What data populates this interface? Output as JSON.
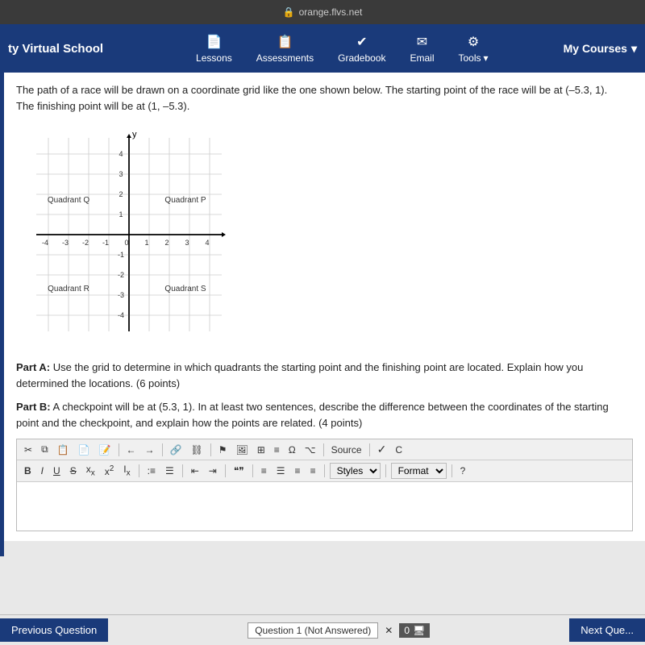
{
  "browser": {
    "url": "orange.flvs.net",
    "lock_icon": "🔒"
  },
  "nav": {
    "brand": "ty Virtual School",
    "lessons_label": "Lessons",
    "assessments_label": "Assessments",
    "gradebook_label": "Gradebook",
    "email_label": "Email",
    "tools_label": "Tools",
    "my_courses_label": "My Courses"
  },
  "content": {
    "question_text_line1": "The path of a race will be drawn on a coordinate grid like the one shown below. The starting point of the race will be at (–5.3, 1).",
    "question_text_line2": "The finishing point will be at (1, –5.3).",
    "part_a_label": "Part A:",
    "part_a_text": " Use the grid to determine in which quadrants the starting point and the finishing point are located. Explain how you determined the locations. (6 points)",
    "part_b_label": "Part B:",
    "part_b_text": " A checkpoint will be at (5.3, 1). In at least two sentences, describe the difference between the coordinates of the starting point and the checkpoint, and explain how the points are related. (4 points)"
  },
  "toolbar": {
    "source_label": "Source",
    "styles_label": "Styles",
    "format_label": "Format",
    "help_label": "?"
  },
  "bottom": {
    "prev_label": "Previous Question",
    "next_label": "Next Que...",
    "question_status": "Question 1 (Not Answered)",
    "zero_label": "0"
  },
  "grid": {
    "quadrant_q": "Quadrant Q",
    "quadrant_p": "Quadrant P",
    "quadrant_r": "Quadrant R",
    "quadrant_s": "Quadrant S"
  }
}
